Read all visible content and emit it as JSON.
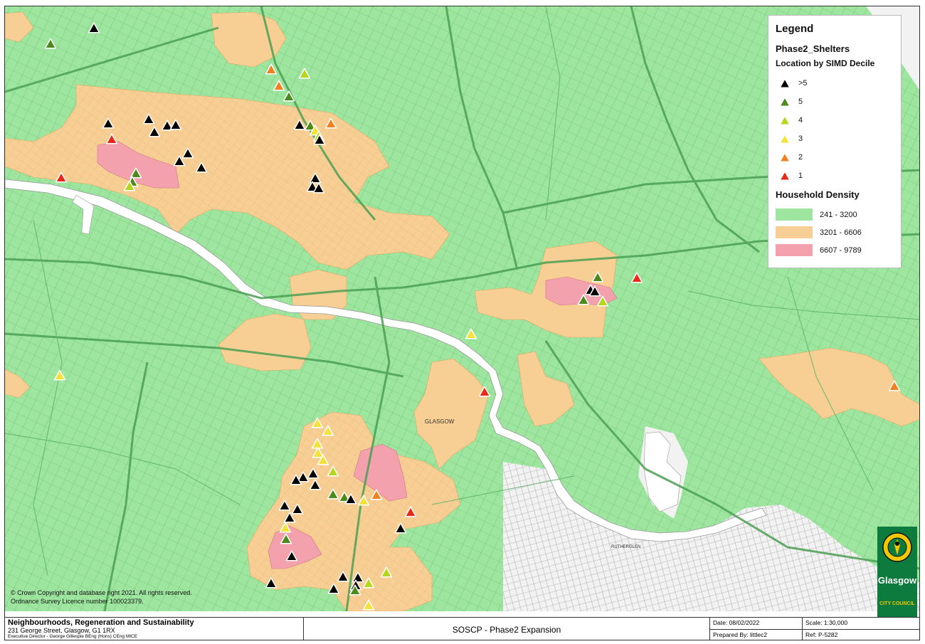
{
  "legend": {
    "title": "Legend",
    "layer_name": "Phase2_Shelters",
    "subtitle": "Location by SIMD Decile",
    "deciles": [
      {
        "label": ">5",
        "color": "#000000"
      },
      {
        "label": "5",
        "color": "#4d8a1e"
      },
      {
        "label": "4",
        "color": "#b5d61d"
      },
      {
        "label": "3",
        "color": "#f4e23a"
      },
      {
        "label": "2",
        "color": "#f08020"
      },
      {
        "label": "1",
        "color": "#e8281a"
      }
    ],
    "density_title": "Household Density",
    "density": [
      {
        "label": "241 - 3200",
        "color": "#9ee6a0"
      },
      {
        "label": "3201 - 6606",
        "color": "#f7cf94"
      },
      {
        "label": "6607 - 9789",
        "color": "#f2a1ad"
      }
    ]
  },
  "map": {
    "place_label": "GLASGOW",
    "place_label_2": "RUTHERGLEN",
    "copyright_line1": "© Crown Copyright and database right 2021. All rights reserved.",
    "copyright_line2": "Ordnance Survey Licence number 100023379.",
    "colors": {
      "base_green": "#9ee6a0",
      "medium": "#f7cf94",
      "high": "#f2a1ad",
      "river": "#ffffff",
      "roads": "#4b9f52",
      "outside": "#ececec"
    }
  },
  "logo": {
    "name": "Glasgow",
    "subtitle": "CITY COUNCIL"
  },
  "footer": {
    "org": "Neighbourhoods, Regeneration and Sustainability",
    "address": "231 George Street, Glasgow, G1 1RX",
    "director": "Executive Director - George Gillespie BEng (Hons) CEng MICE",
    "map_title": "SOSCP - Phase2 Expansion",
    "date": "Date:  08/02/2022",
    "scale": "Scale:  1:30,000",
    "prepared_by": "Prepared By:  littlec2",
    "ref": "Ref:  P-5282"
  }
}
